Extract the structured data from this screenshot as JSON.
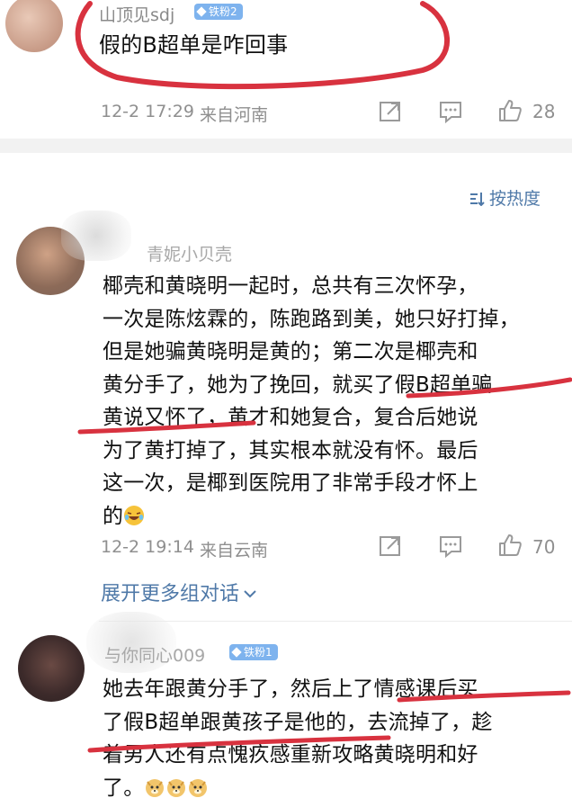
{
  "comments": [
    {
      "username": "山顶见sdj",
      "badge": "铁粉2",
      "text": "假的B超单是咋回事",
      "date": "12-2 17:29",
      "location": "来自河南",
      "likes": "28"
    },
    {
      "username": "青妮小贝壳",
      "badge": "",
      "lines": [
        "椰壳和黄晓明一起时，总共有三次怀孕，",
        "一次是陈炫霖的，陈跑路到美，她只好打掉，",
        "但是她骗黄晓明是黄的；第二次是椰壳和",
        "黄分手了，她为了挽回，就买了假B超单骗",
        "黄说又怀了，黄才和她复合，复合后她说",
        "为了黄打掉了，其实根本就没有怀。最后",
        "这一次，是椰到医院用了非常手段才怀上",
        "的"
      ],
      "date": "12-2 19:14",
      "location": "来自云南",
      "likes": "70"
    },
    {
      "username": "与你同心009",
      "badge": "铁粉1",
      "lines": [
        "她去年跟黄分手了，然后上了情感课后买",
        "了假B超单跟黄孩子是他的，去流掉了，趁",
        "着男人还有点愧疚感重新攻略黄晓明和好",
        "了。"
      ]
    }
  ],
  "sort_label": "按热度",
  "expand_label": "展开更多组对话",
  "colors": {
    "link": "#4f79a8",
    "badge": "#7eb3ee",
    "annotation": "#d8323f",
    "meta": "#8f8f8f"
  }
}
